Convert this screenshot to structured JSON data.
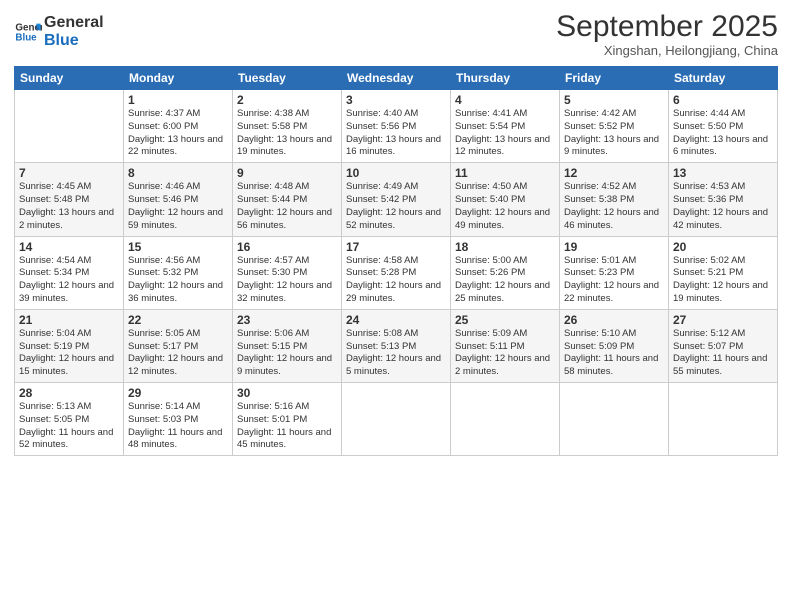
{
  "logo": {
    "line1": "General",
    "line2": "Blue"
  },
  "title": "September 2025",
  "subtitle": "Xingshan, Heilongjiang, China",
  "headers": [
    "Sunday",
    "Monday",
    "Tuesday",
    "Wednesday",
    "Thursday",
    "Friday",
    "Saturday"
  ],
  "weeks": [
    [
      {
        "date": "",
        "info": ""
      },
      {
        "date": "1",
        "info": "Sunrise: 4:37 AM\nSunset: 6:00 PM\nDaylight: 13 hours\nand 22 minutes."
      },
      {
        "date": "2",
        "info": "Sunrise: 4:38 AM\nSunset: 5:58 PM\nDaylight: 13 hours\nand 19 minutes."
      },
      {
        "date": "3",
        "info": "Sunrise: 4:40 AM\nSunset: 5:56 PM\nDaylight: 13 hours\nand 16 minutes."
      },
      {
        "date": "4",
        "info": "Sunrise: 4:41 AM\nSunset: 5:54 PM\nDaylight: 13 hours\nand 12 minutes."
      },
      {
        "date": "5",
        "info": "Sunrise: 4:42 AM\nSunset: 5:52 PM\nDaylight: 13 hours\nand 9 minutes."
      },
      {
        "date": "6",
        "info": "Sunrise: 4:44 AM\nSunset: 5:50 PM\nDaylight: 13 hours\nand 6 minutes."
      }
    ],
    [
      {
        "date": "7",
        "info": "Sunrise: 4:45 AM\nSunset: 5:48 PM\nDaylight: 13 hours\nand 2 minutes."
      },
      {
        "date": "8",
        "info": "Sunrise: 4:46 AM\nSunset: 5:46 PM\nDaylight: 12 hours\nand 59 minutes."
      },
      {
        "date": "9",
        "info": "Sunrise: 4:48 AM\nSunset: 5:44 PM\nDaylight: 12 hours\nand 56 minutes."
      },
      {
        "date": "10",
        "info": "Sunrise: 4:49 AM\nSunset: 5:42 PM\nDaylight: 12 hours\nand 52 minutes."
      },
      {
        "date": "11",
        "info": "Sunrise: 4:50 AM\nSunset: 5:40 PM\nDaylight: 12 hours\nand 49 minutes."
      },
      {
        "date": "12",
        "info": "Sunrise: 4:52 AM\nSunset: 5:38 PM\nDaylight: 12 hours\nand 46 minutes."
      },
      {
        "date": "13",
        "info": "Sunrise: 4:53 AM\nSunset: 5:36 PM\nDaylight: 12 hours\nand 42 minutes."
      }
    ],
    [
      {
        "date": "14",
        "info": "Sunrise: 4:54 AM\nSunset: 5:34 PM\nDaylight: 12 hours\nand 39 minutes."
      },
      {
        "date": "15",
        "info": "Sunrise: 4:56 AM\nSunset: 5:32 PM\nDaylight: 12 hours\nand 36 minutes."
      },
      {
        "date": "16",
        "info": "Sunrise: 4:57 AM\nSunset: 5:30 PM\nDaylight: 12 hours\nand 32 minutes."
      },
      {
        "date": "17",
        "info": "Sunrise: 4:58 AM\nSunset: 5:28 PM\nDaylight: 12 hours\nand 29 minutes."
      },
      {
        "date": "18",
        "info": "Sunrise: 5:00 AM\nSunset: 5:26 PM\nDaylight: 12 hours\nand 25 minutes."
      },
      {
        "date": "19",
        "info": "Sunrise: 5:01 AM\nSunset: 5:23 PM\nDaylight: 12 hours\nand 22 minutes."
      },
      {
        "date": "20",
        "info": "Sunrise: 5:02 AM\nSunset: 5:21 PM\nDaylight: 12 hours\nand 19 minutes."
      }
    ],
    [
      {
        "date": "21",
        "info": "Sunrise: 5:04 AM\nSunset: 5:19 PM\nDaylight: 12 hours\nand 15 minutes."
      },
      {
        "date": "22",
        "info": "Sunrise: 5:05 AM\nSunset: 5:17 PM\nDaylight: 12 hours\nand 12 minutes."
      },
      {
        "date": "23",
        "info": "Sunrise: 5:06 AM\nSunset: 5:15 PM\nDaylight: 12 hours\nand 9 minutes."
      },
      {
        "date": "24",
        "info": "Sunrise: 5:08 AM\nSunset: 5:13 PM\nDaylight: 12 hours\nand 5 minutes."
      },
      {
        "date": "25",
        "info": "Sunrise: 5:09 AM\nSunset: 5:11 PM\nDaylight: 12 hours\nand 2 minutes."
      },
      {
        "date": "26",
        "info": "Sunrise: 5:10 AM\nSunset: 5:09 PM\nDaylight: 11 hours\nand 58 minutes."
      },
      {
        "date": "27",
        "info": "Sunrise: 5:12 AM\nSunset: 5:07 PM\nDaylight: 11 hours\nand 55 minutes."
      }
    ],
    [
      {
        "date": "28",
        "info": "Sunrise: 5:13 AM\nSunset: 5:05 PM\nDaylight: 11 hours\nand 52 minutes."
      },
      {
        "date": "29",
        "info": "Sunrise: 5:14 AM\nSunset: 5:03 PM\nDaylight: 11 hours\nand 48 minutes."
      },
      {
        "date": "30",
        "info": "Sunrise: 5:16 AM\nSunset: 5:01 PM\nDaylight: 11 hours\nand 45 minutes."
      },
      {
        "date": "",
        "info": ""
      },
      {
        "date": "",
        "info": ""
      },
      {
        "date": "",
        "info": ""
      },
      {
        "date": "",
        "info": ""
      }
    ]
  ]
}
